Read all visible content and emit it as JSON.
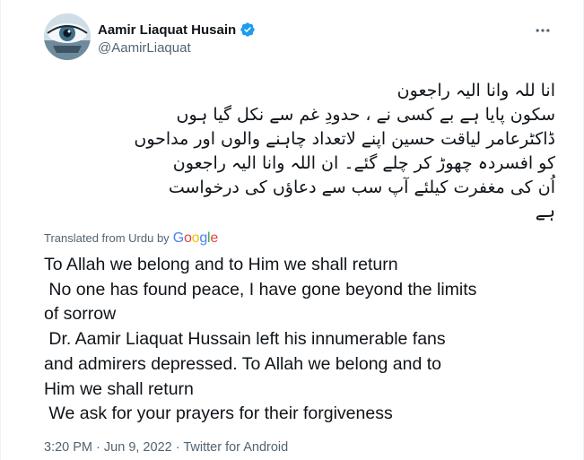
{
  "tweet": {
    "author": {
      "display_name": "Aamir Liaquat Husain",
      "handle": "@AamirLiaquat",
      "verified": true
    },
    "more_icon": "more-dots-icon",
    "urdu_lines": [
      "انا للہ وانا الیہ راجعون",
      "سکون پایا ہے بے کسی نے ، حدودِ غم سے نکل گیا ہوں",
      "ڈاکٹرعامر لیاقت حسین اپنے لاتعداد چاہنے والوں اور مداحوں",
      "کو افسردہ چھوڑ کر چلے گئے۔ ان اللہ وانا الیہ راجعون",
      "اُن کی مغفرت کیلئے آپ سب سے دعاؤں کی درخواست",
      "ہے"
    ],
    "translation": {
      "label": "Translated from Urdu by",
      "provider": "Google"
    },
    "english_lines": [
      "To Allah we belong and to Him we shall return",
      " No one has found peace, I have gone beyond the limits",
      "of sorrow",
      " Dr. Aamir Liaquat Hussain left his innumerable fans",
      "and admirers depressed. To Allah we belong and to",
      "Him we shall return",
      " We ask for your prayers for their forgiveness"
    ],
    "time": "3:20 PM",
    "separator_1": "·",
    "date": "Jun 9, 2022",
    "separator_2": "·",
    "source": "Twitter for Android"
  },
  "colors": {
    "text": "#0f1419",
    "secondary": "#536471",
    "verified_blue": "#1d9bf0"
  }
}
